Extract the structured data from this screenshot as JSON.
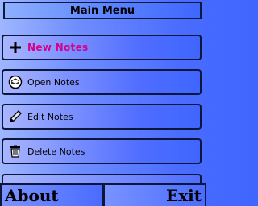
{
  "header": {
    "title": "Main Menu"
  },
  "menu": {
    "items": [
      {
        "label": "New Notes",
        "icon": "plus-icon"
      },
      {
        "label": "Open Notes",
        "icon": "open-mailbox-icon"
      },
      {
        "label": "Edit Notes",
        "icon": "pencil-icon"
      },
      {
        "label": "Delete Notes",
        "icon": "trash-icon"
      }
    ]
  },
  "softkeys": {
    "left": "About",
    "right": "Exit"
  },
  "colors": {
    "accent_new": "#d4008f",
    "border": "#0b163a",
    "background_light": "#a9b6ff",
    "background_dark": "#3f66ff"
  }
}
